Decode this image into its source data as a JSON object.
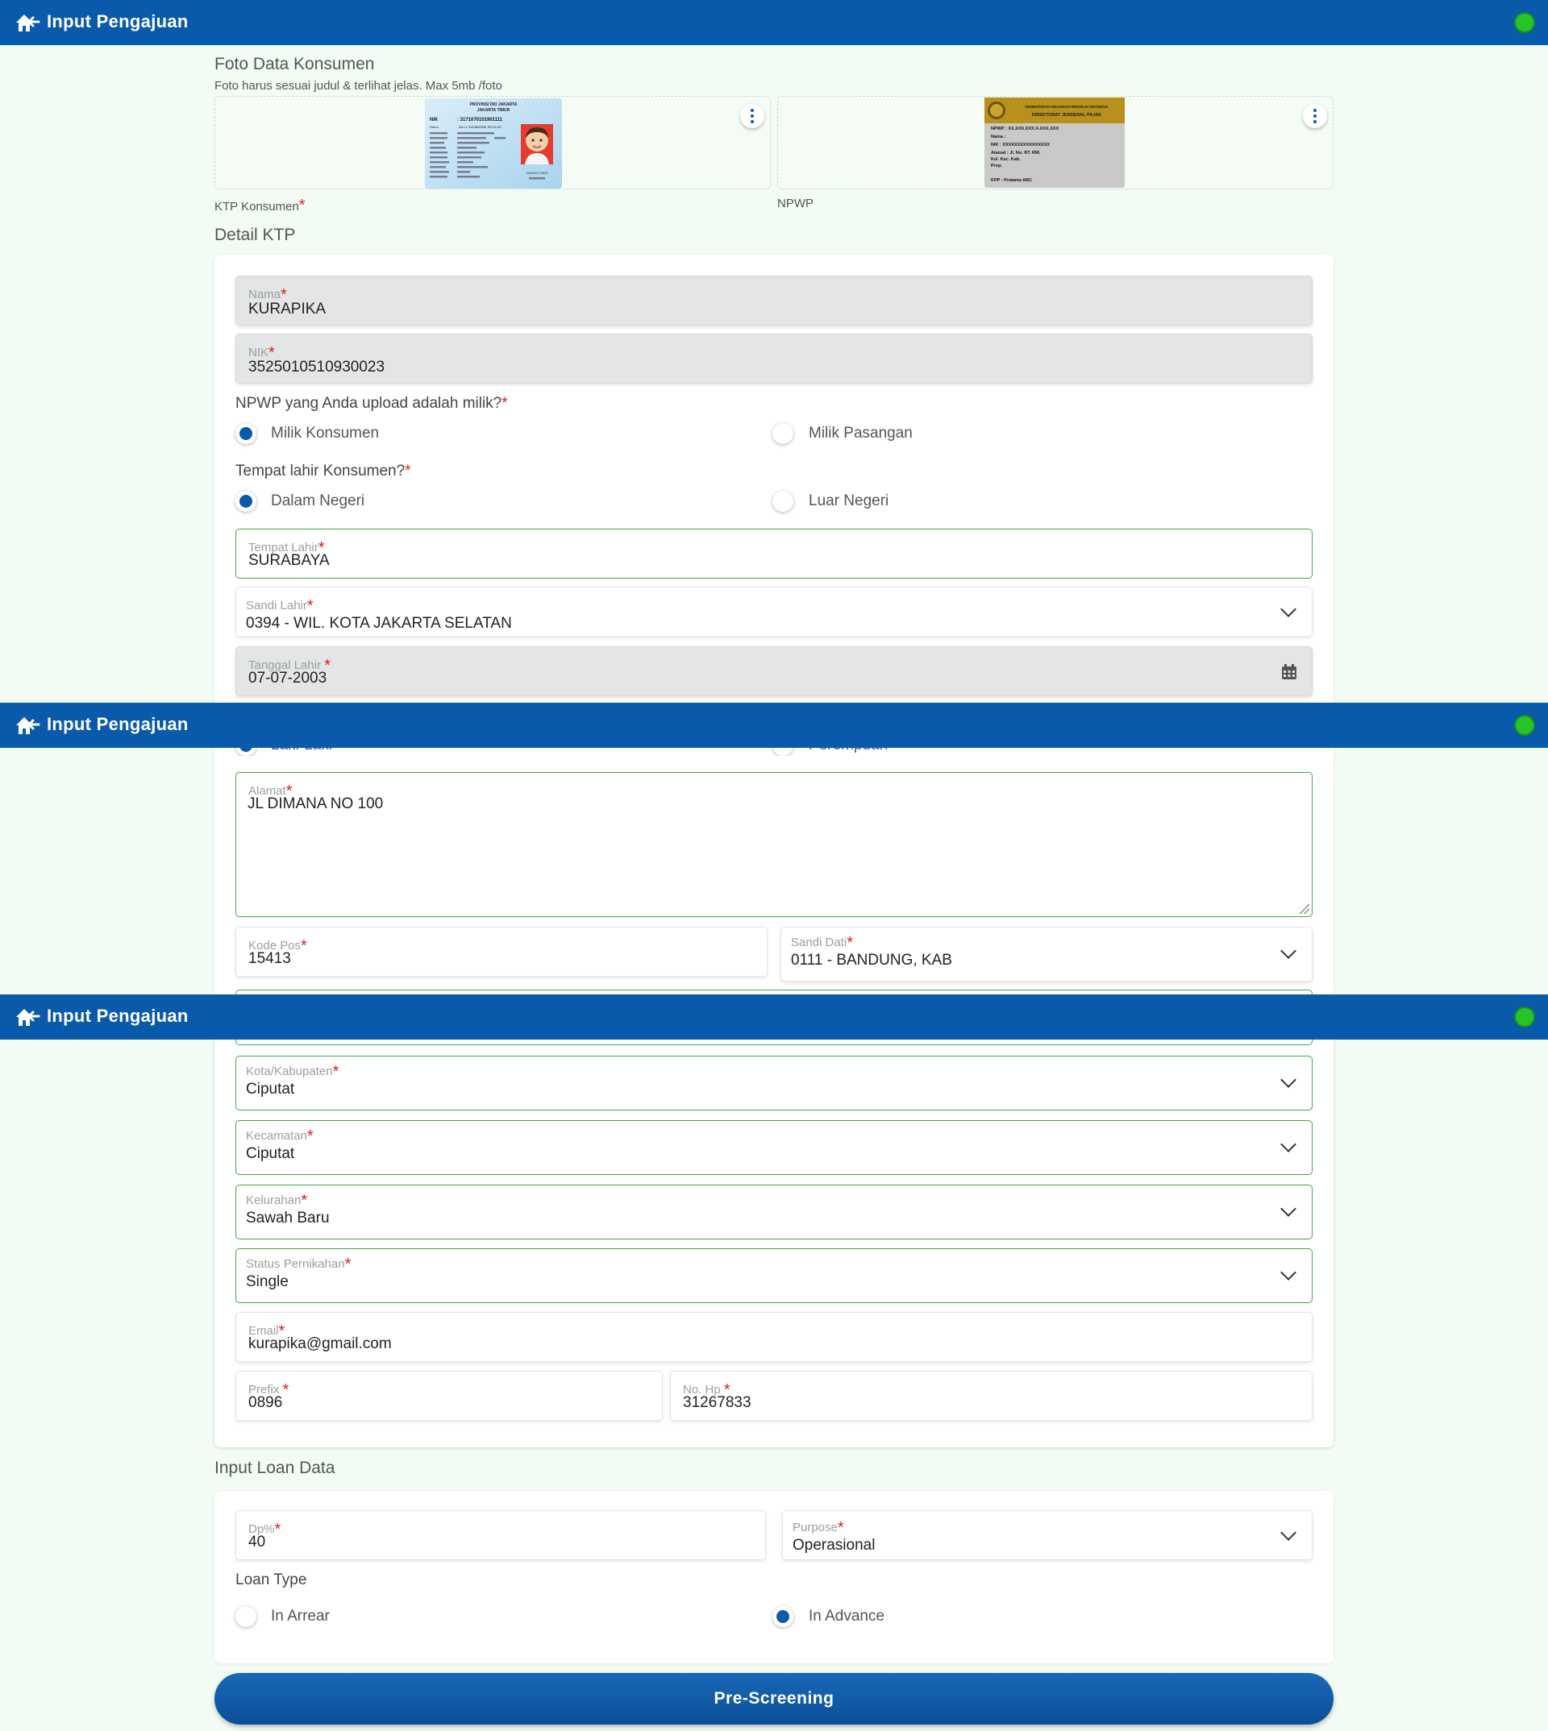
{
  "header": {
    "title": "Input Pengajuan"
  },
  "photos": {
    "section_title": "Foto Data Konsumen",
    "subtitle": "Foto harus sesuai judul & terlihat jelas. Max 5mb /foto",
    "ktp_label": "KTP Konsumen",
    "npwp_label": "NPWP",
    "ktp_card": {
      "province": "PROVINSI DKI JAKARTA",
      "city": "JAKARTA TIMUR",
      "nik_label": "NIK",
      "nik": ": 3171070101901111",
      "nama_label": "Nama",
      "nama": ": BILLY SUMBURBE SIPULAG",
      "footer": "JAKARTA TIMUR"
    },
    "npwp_card": {
      "header": "KEMENTERIAN KEUANGAN REPUBLIK INDONESIA",
      "subheader": "DIREKTORAT JENDERAL PAJAK",
      "npwp_line": "NPWP : XX.XXX.XXX.X-XXX.XXX",
      "nama_line": "Nama :",
      "nik_line": "NIK : XXXXXXXXXXXXXXXX",
      "alamat_line": "Alamat : Jl.          No.    RT.  RW.",
      "kel_line": "Kel.               Kec.           Kab.",
      "prop_line": "Prop.",
      "kpp_line": "KPP : Pratama ABC"
    }
  },
  "detail": {
    "section_title": "Detail KTP",
    "nama": {
      "label": "Nama",
      "value": "KURAPIKA"
    },
    "nik": {
      "label": "NIK",
      "value": "3525010510930023"
    },
    "npwp_owner": {
      "question": "NPWP yang Anda upload adalah milik?",
      "options": [
        "Milik Konsumen",
        "Milik Pasangan"
      ],
      "selected": "Milik Konsumen"
    },
    "birth_place_type": {
      "question": "Tempat lahir Konsumen?",
      "options": [
        "Dalam Negeri",
        "Luar Negeri"
      ],
      "selected": "Dalam Negeri"
    },
    "tempat_lahir": {
      "label": "Tempat Lahir",
      "value": "SURABAYA"
    },
    "sandi_lahir": {
      "label": "Sandi Lahir",
      "value": "0394 - WIL. KOTA JAKARTA SELATAN"
    },
    "tanggal_lahir": {
      "label": "Tanggal Lahir ",
      "value": "07-07-2003"
    },
    "gender": {
      "options": [
        "Laki-Laki",
        "Perempuan"
      ],
      "selected": "Laki-Laki"
    },
    "alamat": {
      "label": "Alamat",
      "value": "JL DIMANA NO 100"
    },
    "kode_pos": {
      "label": "Kode Pos",
      "value": "15413"
    },
    "sandi_dati": {
      "label": "Sandi Dati",
      "value": "0111 - BANDUNG, KAB"
    },
    "kota": {
      "label": "Kota/Kabupaten",
      "value": "Ciputat"
    },
    "kecamatan": {
      "label": "Kecamatan",
      "value": "Ciputat"
    },
    "kelurahan": {
      "label": "Kelurahan",
      "value": "Sawah Baru"
    },
    "status_pernikahan": {
      "label": "Status Pernikahan",
      "value": "Single"
    },
    "email": {
      "label": "Email",
      "value": "kurapika@gmail.com"
    },
    "prefix": {
      "label": "Prefix ",
      "value": "0896"
    },
    "no_hp": {
      "label": "No. Hp ",
      "value": "31267833"
    }
  },
  "loan": {
    "section_title": "Input Loan Data",
    "dp": {
      "label": "Dp%",
      "value": "40"
    },
    "purpose": {
      "label": "Purpose",
      "value": "Operasional"
    },
    "loan_type": {
      "question": "Loan Type",
      "options": [
        "In Arrear",
        "In Advance"
      ],
      "selected": "In Advance"
    }
  },
  "actions": {
    "submit_label": "Pre-Screening"
  },
  "colors": {
    "header": "#0a5aab",
    "status_dot": "#27c32c",
    "active_border": "#3ea84b",
    "required": "#e01b1b",
    "background": "#f2fbf4"
  },
  "icons": {
    "back": "home-back-icon",
    "status": "status-dot-icon",
    "menu": "kebab-menu-icon",
    "dropdown": "chevron-down-icon",
    "date": "calendar-icon"
  }
}
